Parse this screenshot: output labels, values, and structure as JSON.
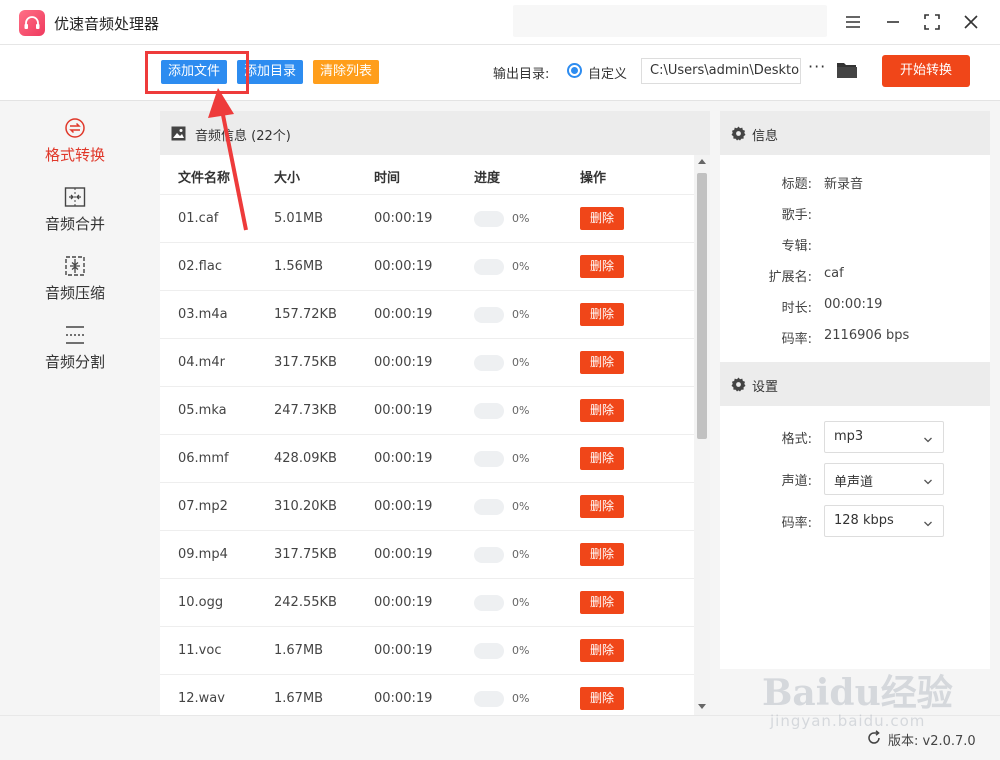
{
  "app": {
    "title": "优速音频处理器"
  },
  "toolbar": {
    "add_file": "添加文件",
    "add_dir": "添加目录",
    "clear_list": "清除列表",
    "output_label": "输出目录:",
    "output_mode": "自定义",
    "output_path": "C:\\Users\\admin\\Deskto",
    "more": "···",
    "start": "开始转换"
  },
  "sidebar": {
    "items": [
      {
        "label": "格式转换",
        "icon": "convert-icon",
        "active": true
      },
      {
        "label": "音频合并",
        "icon": "merge-icon",
        "active": false
      },
      {
        "label": "音频压缩",
        "icon": "compress-icon",
        "active": false
      },
      {
        "label": "音频分割",
        "icon": "split-icon",
        "active": false
      }
    ]
  },
  "file_list": {
    "title": "音频信息 (22个)",
    "columns": [
      "文件名称",
      "大小",
      "时间",
      "进度",
      "操作"
    ],
    "rows": [
      {
        "name": "01.caf",
        "size": "5.01MB",
        "time": "00:00:19",
        "progress": "0%",
        "action": "删除"
      },
      {
        "name": "02.flac",
        "size": "1.56MB",
        "time": "00:00:19",
        "progress": "0%",
        "action": "删除"
      },
      {
        "name": "03.m4a",
        "size": "157.72KB",
        "time": "00:00:19",
        "progress": "0%",
        "action": "删除"
      },
      {
        "name": "04.m4r",
        "size": "317.75KB",
        "time": "00:00:19",
        "progress": "0%",
        "action": "删除"
      },
      {
        "name": "05.mka",
        "size": "247.73KB",
        "time": "00:00:19",
        "progress": "0%",
        "action": "删除"
      },
      {
        "name": "06.mmf",
        "size": "428.09KB",
        "time": "00:00:19",
        "progress": "0%",
        "action": "删除"
      },
      {
        "name": "07.mp2",
        "size": "310.20KB",
        "time": "00:00:19",
        "progress": "0%",
        "action": "删除"
      },
      {
        "name": "09.mp4",
        "size": "317.75KB",
        "time": "00:00:19",
        "progress": "0%",
        "action": "删除"
      },
      {
        "name": "10.ogg",
        "size": "242.55KB",
        "time": "00:00:19",
        "progress": "0%",
        "action": "删除"
      },
      {
        "name": "11.voc",
        "size": "1.67MB",
        "time": "00:00:19",
        "progress": "0%",
        "action": "删除"
      },
      {
        "name": "12.wav",
        "size": "1.67MB",
        "time": "00:00:19",
        "progress": "0%",
        "action": "删除"
      }
    ]
  },
  "info_panel": {
    "title": "信息",
    "rows": [
      {
        "key": "标题:",
        "value": "新录音"
      },
      {
        "key": "歌手:",
        "value": ""
      },
      {
        "key": "专辑:",
        "value": ""
      },
      {
        "key": "扩展名:",
        "value": "caf"
      },
      {
        "key": "时长:",
        "value": "00:00:19"
      },
      {
        "key": "码率:",
        "value": "2116906 bps"
      }
    ]
  },
  "settings_panel": {
    "title": "设置",
    "rows": [
      {
        "key": "格式:",
        "value": "mp3"
      },
      {
        "key": "声道:",
        "value": "单声道"
      },
      {
        "key": "码率:",
        "value": "128 kbps"
      }
    ]
  },
  "footer": {
    "version": "版本: v2.0.7.0"
  },
  "watermark": {
    "text": "Baidu经验",
    "sub": "jingyan.baidu.com"
  },
  "colors": {
    "accent_blue": "#2d8cf0",
    "accent_orange": "#ff9e1b",
    "danger": "#f04619",
    "active_red": "#e0382a",
    "annotation_red": "#ee3b3b"
  }
}
